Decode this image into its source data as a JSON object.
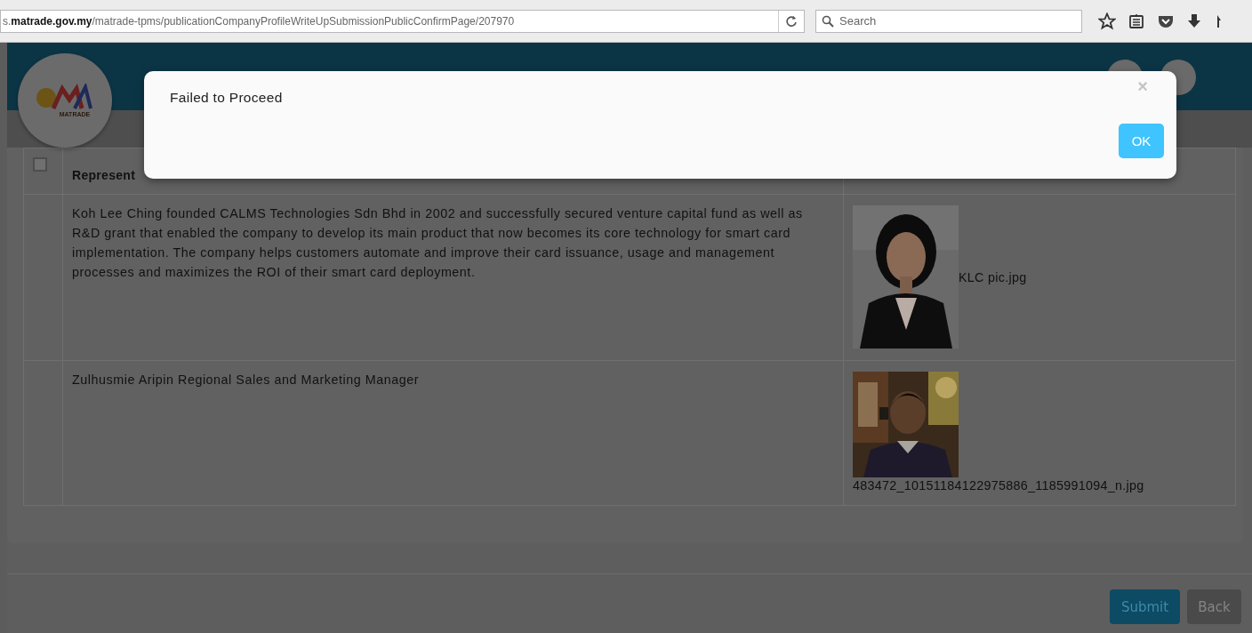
{
  "browser": {
    "url": "s.**matrade.gov.my**/matrade-tpms/publicationCompanyProfileWriteUpSubmissionPublicConfirmPage/207970",
    "search": {
      "placeholder": "Search"
    }
  },
  "header": {
    "logo_text": "MATRADE"
  },
  "table": {
    "header_checkbox": {
      "checked": false
    },
    "columns": [
      {
        "label": "Represent"
      }
    ],
    "rows": [
      {
        "description": "Koh Lee Ching founded CALMS Technologies Sdn Bhd in 2002 and successfully secured venture capital fund as well as R&D grant that enabled the company to develop its main product that now becomes its core technology for smart card implementation. The company helps customers automate and improve their card issuance, usage and management processes and maximizes the ROI of their smart card deployment.",
        "filename": "KLC pic.jpg"
      },
      {
        "description": "Zulhusmie Aripin Regional Sales and Marketing Manager",
        "filename": "483472_10151184122975886_1185991094_n.jpg"
      }
    ]
  },
  "buttons": [
    {
      "label": "Submit",
      "kind": "primary"
    },
    {
      "label": "Back",
      "kind": "secondary"
    }
  ],
  "dialog": {
    "message": "Failed to Proceed",
    "close": "×",
    "ok": "OK"
  }
}
